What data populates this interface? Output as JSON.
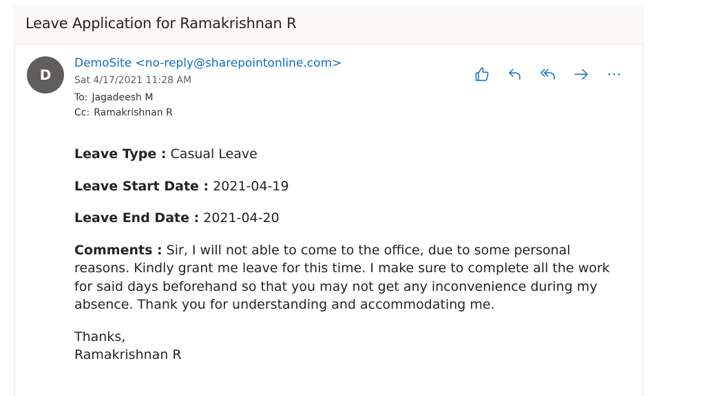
{
  "email": {
    "subject": "Leave Application for Ramakrishnan R",
    "avatar_initial": "D",
    "sender": "DemoSite <no-reply@sharepointonline.com>",
    "date": "Sat 4/17/2021 11:28 AM",
    "to_label": "To:",
    "to": "Jagadeesh M",
    "cc_label": "Cc:",
    "cc": "Ramakrishnan R"
  },
  "actions": [
    {
      "name": "like",
      "icon": "thumbs-up-icon"
    },
    {
      "name": "reply",
      "icon": "reply-icon"
    },
    {
      "name": "reply-all",
      "icon": "reply-all-icon"
    },
    {
      "name": "forward",
      "icon": "forward-icon"
    },
    {
      "name": "more",
      "icon": "more-icon"
    }
  ],
  "body": {
    "leave_type_label": "Leave Type :",
    "leave_type": " Casual Leave",
    "start_label": "Leave Start Date :",
    "start": " 2021-04-19",
    "end_label": "Leave End Date :",
    "end": " 2021-04-20",
    "comments_label": "Comments :",
    "comments": " Sir, I will not able to come to the office, due to some personal reasons. Kindly grant me leave for this time. I make sure to complete all the work for said days beforehand so that you may not get any inconvenience during my absence. Thank you for understanding and accommodating me.",
    "closing": "Thanks,",
    "signature": "Ramakrishnan R"
  },
  "colors": {
    "accent": "#106ebe",
    "avatar": "#605e5c",
    "icon": "#0f6cbd"
  }
}
